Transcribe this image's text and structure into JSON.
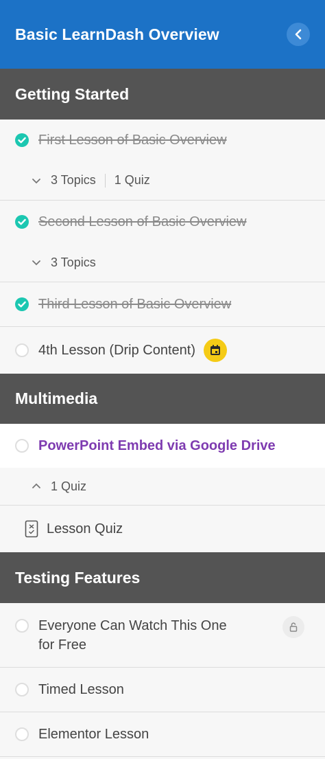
{
  "header": {
    "title": "Basic LearnDash Overview"
  },
  "sections": [
    {
      "title": "Getting Started",
      "lessons": [
        {
          "title": "First Lesson of Basic Overview",
          "status": "complete",
          "meta": {
            "topics": "3 Topics",
            "quiz": "1 Quiz"
          }
        },
        {
          "title": "Second Lesson of Basic Overview",
          "status": "complete",
          "meta": {
            "topics": "3 Topics"
          }
        },
        {
          "title": "Third Lesson of Basic Overview",
          "status": "complete"
        },
        {
          "title": "4th Lesson (Drip Content)",
          "status": "incomplete",
          "badge": "calendar-icon"
        }
      ]
    },
    {
      "title": "Multimedia",
      "lessons": [
        {
          "title": "PowerPoint Embed via Google Drive",
          "status": "incomplete",
          "current": true,
          "meta": {
            "quiz": "1 Quiz"
          },
          "quizzes": [
            "Lesson Quiz"
          ]
        }
      ]
    },
    {
      "title": "Testing Features",
      "lessons": [
        {
          "title_line1": "Everyone Can Watch This One",
          "title_line2": "for Free",
          "status": "incomplete",
          "badge": "unlock-icon"
        },
        {
          "title": "Timed Lesson",
          "status": "incomplete"
        },
        {
          "title": "Elementor Lesson",
          "status": "incomplete"
        }
      ]
    }
  ],
  "colors": {
    "header_bg": "#1c72c6",
    "section_bg": "#545454",
    "complete_check": "#1cc7b1",
    "current_lesson": "#7e3bb0",
    "calendar_badge": "#f5cb16"
  }
}
